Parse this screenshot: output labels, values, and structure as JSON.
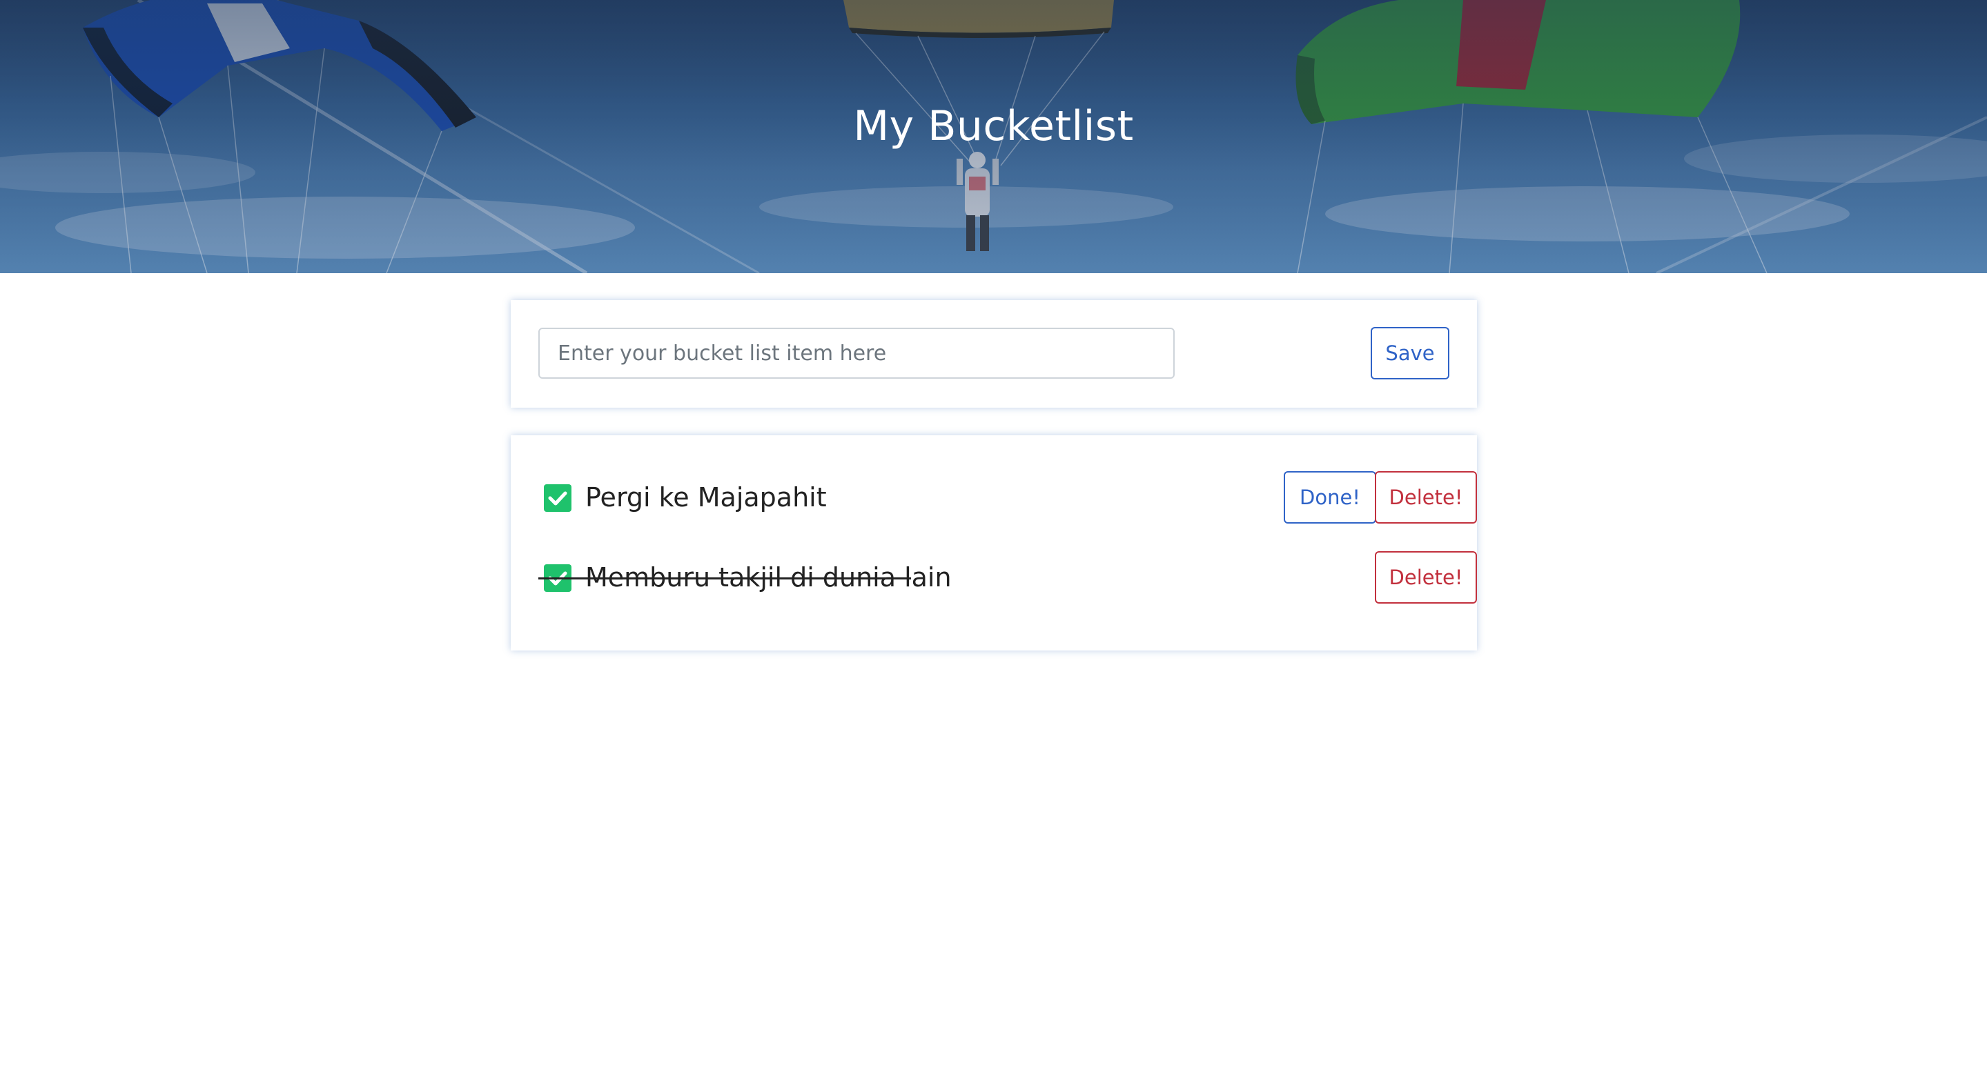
{
  "header": {
    "title": "My Bucketlist"
  },
  "form": {
    "placeholder": "Enter your bucket list item here",
    "value": "",
    "save_label": "Save"
  },
  "items": [
    {
      "text": "Pergi ke Majapahit",
      "checked": true,
      "completed": false,
      "done_label": "Done!",
      "delete_label": "Delete!"
    },
    {
      "text": "Memburu takjil di dunia lain",
      "checked": true,
      "completed": true,
      "delete_label": "Delete!"
    }
  ],
  "icons": {
    "checkbox": "checkmark-icon",
    "background": "parachutes-sky-image"
  },
  "colors": {
    "primary": "#2f63c7",
    "danger": "#c2303d",
    "check": "#1fc26c",
    "card_shadow": "#4678be"
  }
}
